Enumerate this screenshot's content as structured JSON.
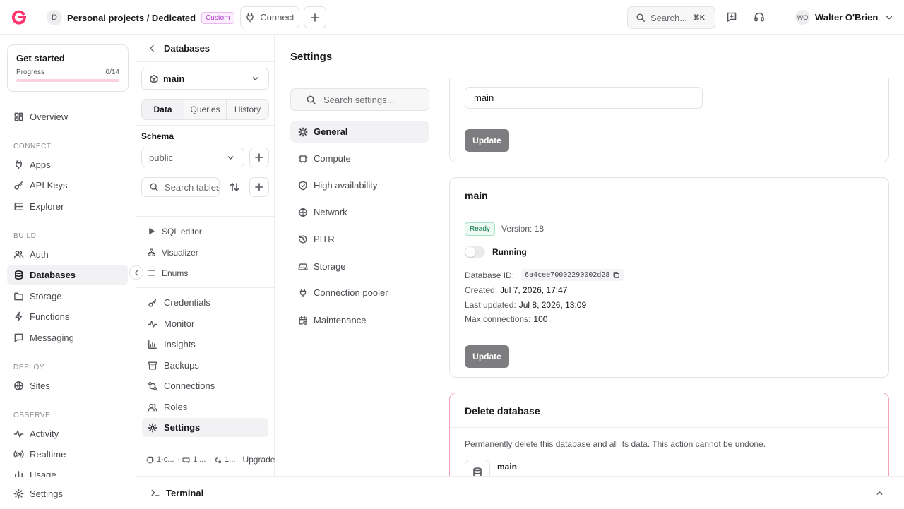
{
  "topbar": {
    "project_initial": "D",
    "project_name": "Personal projects / Dedicated",
    "project_badge": "Custom",
    "connect_label": "Connect",
    "search_placeholder": "Search...",
    "search_shortcut": "⌘K",
    "user_initials": "WO",
    "user_name": "Walter O'Brien"
  },
  "get_started": {
    "title": "Get started",
    "progress_label": "Progress",
    "progress_text": "0/14",
    "progress_fraction": 0
  },
  "nav": {
    "overview": "Overview",
    "connect_section": "CONNECT",
    "apps": "Apps",
    "api_keys": "API Keys",
    "explorer": "Explorer",
    "build_section": "BUILD",
    "auth": "Auth",
    "databases": "Databases",
    "storage": "Storage",
    "functions": "Functions",
    "messaging": "Messaging",
    "deploy_section": "DEPLOY",
    "sites": "Sites",
    "observe_section": "OBSERVE",
    "activity": "Activity",
    "realtime": "Realtime",
    "usage": "Usage",
    "settings": "Settings"
  },
  "dbpanel": {
    "title": "Databases",
    "selected_db": "main",
    "tabs": [
      "Data",
      "Queries",
      "History"
    ],
    "schema_label": "Schema",
    "schema_value": "public",
    "table_search_placeholder": "Search tables",
    "items": {
      "sql_editor": "SQL editor",
      "visualizer": "Visualizer",
      "enums": "Enums",
      "credentials": "Credentials",
      "monitor": "Monitor",
      "insights": "Insights",
      "backups": "Backups",
      "connections": "Connections",
      "roles": "Roles",
      "settings": "Settings"
    },
    "footer": {
      "cpu": "1-c...",
      "mem": "1 ...",
      "conn": "1...",
      "upgrade": "Upgrade"
    }
  },
  "main": {
    "title": "Settings",
    "search_placeholder": "Search settings...",
    "menu": {
      "general": "General",
      "compute": "Compute",
      "high_availability": "High availability",
      "network": "Network",
      "pitr": "PITR",
      "storage": "Storage",
      "connection_pooler": "Connection pooler",
      "maintenance": "Maintenance"
    },
    "name_card": {
      "value": "main",
      "update_label": "Update"
    },
    "info_card": {
      "title": "main",
      "status": "Ready",
      "version": "Version: 18",
      "running_label": "Running",
      "db_id_label": "Database ID:",
      "db_id": "6a4cee70002290002d28",
      "created_label": "Created:",
      "created": "Jul 7, 2026, 17:47",
      "updated_label": "Last updated:",
      "updated": "Jul 8, 2026, 13:09",
      "max_conn_label": "Max connections:",
      "max_conn": "100",
      "update_label": "Update"
    },
    "delete_card": {
      "title": "Delete database",
      "description": "Permanently delete this database and all its data. This action cannot be undone.",
      "db_name": "main"
    }
  },
  "terminal": {
    "label": "Terminal"
  },
  "colors": {
    "brand": "#fd366e",
    "ready": "#0e7a4d",
    "danger_border": "#f5a3b5"
  }
}
